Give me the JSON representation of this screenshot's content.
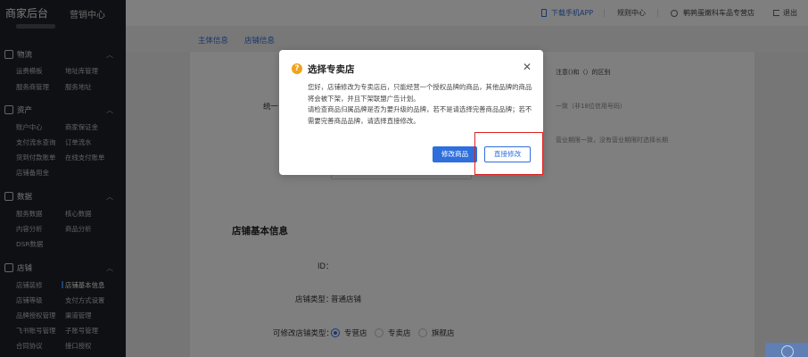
{
  "app": {
    "title": "商家后台",
    "subtitle": "营销中心"
  },
  "sidebar": {
    "sections": [
      {
        "title": "物流",
        "items": [
          "运费模板",
          "地址库管理",
          "服务商管理",
          "服务地址"
        ]
      },
      {
        "title": "资产",
        "items": [
          "账户中心",
          "商家保证金",
          "支付流水查询",
          "订单流水",
          "货到付款账单",
          "在线支付账单",
          "店铺备用金"
        ]
      },
      {
        "title": "数据",
        "items": [
          "服务数据",
          "核心数据",
          "内容分析",
          "商品分析",
          "DSR数据"
        ]
      },
      {
        "title": "店铺",
        "items": [
          "店铺装修",
          "店铺基本信息",
          "店铺等级",
          "支付方式设置",
          "品牌授权管理",
          "渠道管理",
          "飞书账号管理",
          "子账号管理",
          "合同协议",
          "接口授权"
        ]
      }
    ],
    "active_item": "店铺基本信息"
  },
  "topbar": {
    "download_app": "下载手机APP",
    "rules_center": "规则中心",
    "store_name": "鹌鹑蛋嫩科车品专营店",
    "logout": "退出"
  },
  "tabs": [
    "主体信息",
    "店铺信息"
  ],
  "background_form": {
    "hint_right_1": "注意()和（）的区别",
    "hint_right_2": "一致（非18位信用号码）",
    "hint_right_3": "营业期限一致，没有营业期限时选择长期",
    "label_partial": "统一",
    "section_title": "店铺基本信息",
    "id_label": "ID：",
    "store_type_label": "店铺类型：",
    "store_type_value": "普通店铺",
    "modifiable_type_label": "可修改店铺类型：",
    "store_type_options": [
      "专营店",
      "专卖店",
      "旗舰店"
    ],
    "selected_store_type": "专营店"
  },
  "dialog": {
    "title": "选择专卖店",
    "paragraph_1": "您好，店铺修改为专卖店后，只能经营一个授权品牌的商品，其他品牌的商品将会被下架，并且下架联盟广告计划。",
    "paragraph_2": "请检查商品归属品牌是否为要升级的品牌，若不是请选择完善商品品牌；若不需要完善商品品牌，请选择直接修改。",
    "primary_button": "修改商品",
    "secondary_button": "直接修改"
  },
  "colors": {
    "accent": "#2f6fdc",
    "sidebar_bg": "#1f2126",
    "warning": "#f1a31a",
    "highlight_box": "#e02020"
  }
}
